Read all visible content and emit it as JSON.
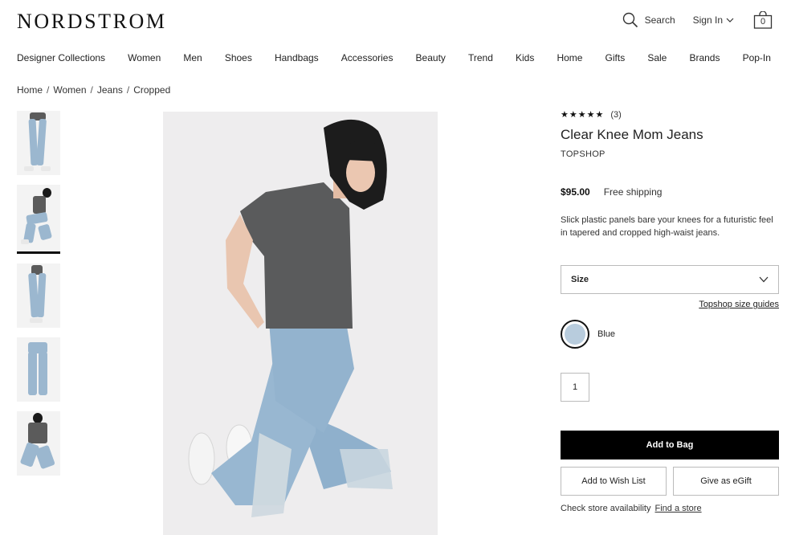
{
  "header": {
    "logo": "NORDSTROM",
    "search_label": "Search",
    "signin_label": "Sign In",
    "bag_count": "0"
  },
  "nav": {
    "items": [
      "Designer Collections",
      "Women",
      "Men",
      "Shoes",
      "Handbags",
      "Accessories",
      "Beauty",
      "Trend",
      "Kids",
      "Home",
      "Gifts",
      "Sale",
      "Brands",
      "Pop-In"
    ]
  },
  "breadcrumb": {
    "items": [
      "Home",
      "Women",
      "Jeans",
      "Cropped"
    ],
    "separator": "/"
  },
  "thumbnails": {
    "selected_index": 1,
    "count": 5
  },
  "product": {
    "stars": "★★★★★",
    "review_count": "(3)",
    "title": "Clear Knee Mom Jeans",
    "brand": "TOPSHOP",
    "price": "$95.00",
    "shipping": "Free shipping",
    "description": "Slick plastic panels bare your knees for a futuristic feel in tapered and cropped high-waist jeans.",
    "size_label": "Size",
    "size_guide": "Topshop size guides",
    "color_name": "Blue",
    "color_hex": "#b8ccdd",
    "quantity": "1",
    "add_to_bag": "Add to Bag",
    "add_to_wishlist": "Add to Wish List",
    "give_egift": "Give as eGift",
    "store_availability": "Check store availability",
    "find_store": "Find a store"
  }
}
